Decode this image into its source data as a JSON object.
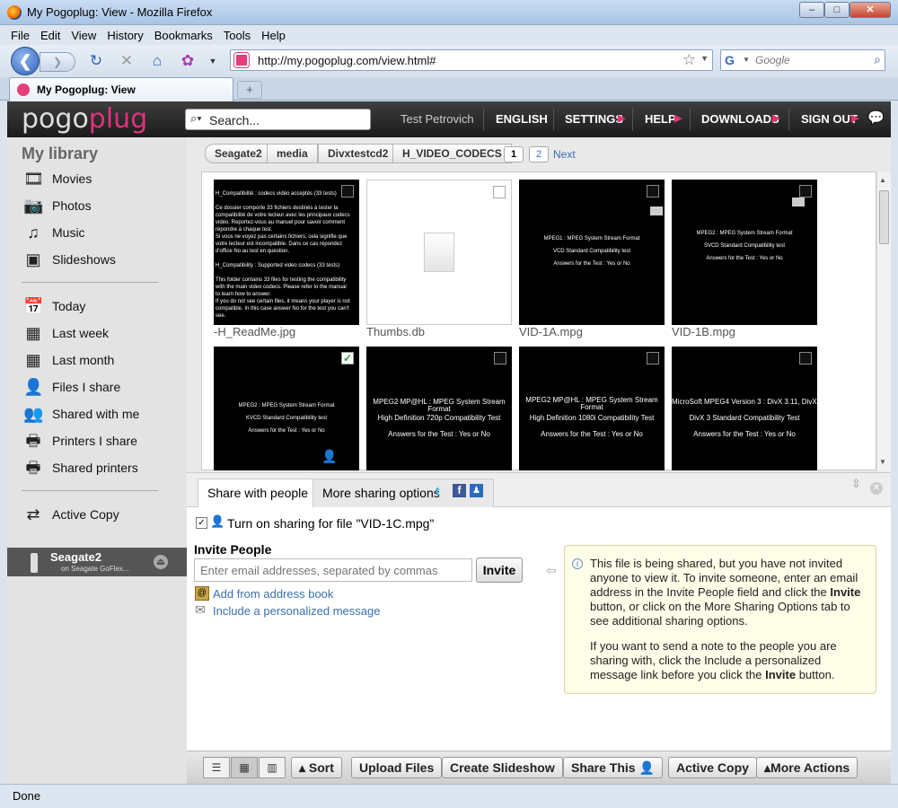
{
  "window": {
    "title": "My Pogoplug: View - Mozilla Firefox",
    "min": "–",
    "max": "□",
    "close": "✕"
  },
  "menu": [
    "File",
    "Edit",
    "View",
    "History",
    "Bookmarks",
    "Tools",
    "Help"
  ],
  "nav": {
    "url": "http://my.pogoplug.com/view.html#",
    "search_placeholder": "Google"
  },
  "tab": {
    "title": "My Pogoplug: View",
    "newtab": "+"
  },
  "header": {
    "logo_a": "pogo",
    "logo_b": "plug",
    "search_text": "Search...",
    "user": "Test Petrovich",
    "language": "ENGLISH",
    "settings": "SETTINGS",
    "help": "HELP",
    "downloads": "DOWNLOADS",
    "signout": "SIGN OUT"
  },
  "sidebar": {
    "title": "My library",
    "media": [
      {
        "label": "Movies",
        "icon": "film-icon"
      },
      {
        "label": "Photos",
        "icon": "camera-icon"
      },
      {
        "label": "Music",
        "icon": "music-note-icon"
      },
      {
        "label": "Slideshows",
        "icon": "slideshow-icon"
      }
    ],
    "time": [
      {
        "label": "Today",
        "icon": "calendar-day-icon"
      },
      {
        "label": "Last week",
        "icon": "calendar-week-icon"
      },
      {
        "label": "Last month",
        "icon": "calendar-month-icon"
      },
      {
        "label": "Files I share",
        "icon": "user-share-icon"
      },
      {
        "label": "Shared with me",
        "icon": "users-icon"
      },
      {
        "label": "Printers I share",
        "icon": "printer-share-icon"
      },
      {
        "label": "Shared printers",
        "icon": "printer-icon"
      }
    ],
    "activecopy": "Active Copy",
    "device": {
      "name": "Seagate2",
      "sub": "on Seagate GoFlex..."
    }
  },
  "breadcrumb": [
    "Seagate2",
    "media",
    "Divxtestcd2",
    "H_VIDEO_CODECS"
  ],
  "pagination": {
    "p1": "1",
    "p2": "2",
    "next": "Next"
  },
  "files": [
    {
      "name": "-H_ReadMe.jpg",
      "lines": [
        "H_Compatibilité : codecs vidéo acceptés (33 tests)",
        "",
        "Ce dossier comporte 33 fichiers destinés à tester la",
        "compatibilité de votre lecteur avec les principaux codecs",
        "vidéo. Reportez-vous au manuel pour savoir comment",
        "répondre à chaque test.",
        "Si vous ne voyez pas certains fichiers, cela signifie que",
        "votre lecteur est incompatible. Dans ce cas répondez",
        "d'office No au test en question.",
        "",
        "H_Compatibility : Supported video codecs  (33 tests)",
        "",
        "This folder contains 33 files for testing the compatibility",
        "with the main video codecs. Please refer to the manual",
        "to learn how to answer.",
        "If you do not see certain files, it means your player is not",
        "compatible. In this case answer No for the test you can't",
        "see."
      ]
    },
    {
      "name": "Thumbs.db",
      "lines": []
    },
    {
      "name": "VID-1A.mpg",
      "lines": [
        "MPEG1 : MPEG System Stream Format",
        "VCD Standard Compatibility test",
        "Answers for the Test : Yes or No"
      ]
    },
    {
      "name": "VID-1B.mpg",
      "lines": [
        "MPEG2 : MPEG System Stream Format",
        "SVCD Standard Compatibility test",
        "Answers for the Test : Yes or No"
      ]
    },
    {
      "name": "",
      "lines": [
        "MPEG2 : MPEG System Stream Format",
        "KVCD Standard Compatibility test",
        "Answers for the Test : Yes or No"
      ]
    },
    {
      "name": "",
      "lines": [
        "MPEG2 MP@HL : MPEG System Stream Format",
        "High Definition 720p Compatibility Test",
        "Answers for the Test : Yes or No"
      ]
    },
    {
      "name": "",
      "lines": [
        "MPEG2 MP@HL : MPEG System Stream Format",
        "High Definition 1080i Compatibility Test",
        "Answers for the Test : Yes or No"
      ]
    },
    {
      "name": "",
      "lines": [
        "MicroSoft MPEG4 Version 3 : DivX 3.11, DivX3.S2",
        "DivX 3 Standard Compatibility Test",
        "Answers for the Test : Yes or No"
      ]
    }
  ],
  "share": {
    "tab_people": "Share with people",
    "tab_more": "More sharing options",
    "toggle_label": "Turn on sharing for file \"VID-1C.mpg\"",
    "invite_heading": "Invite People",
    "email_placeholder": "Enter email addresses, separated by commas",
    "invite_button": "Invite",
    "address_book": "Add from address book",
    "personal_msg": "Include a personalized message",
    "info_1a": "This file is being shared, but you have not invited anyone to view it. To invite someone, enter an email address in the Invite People field and click the ",
    "info_1b": "Invite",
    "info_1c": " button, or click on the More Sharing Options tab to see additional sharing options.",
    "info_2a": "If you want to send a note to the people you are sharing with, click the Include a personalized message link before you click the ",
    "info_2b": "Invite",
    "info_2c": " button."
  },
  "toolbar": {
    "sort": "Sort",
    "upload": "Upload Files",
    "slideshow": "Create Slideshow",
    "share": "Share This",
    "activecopy": "Active Copy",
    "more": "More Actions"
  },
  "status": "Done",
  "colors": {
    "accent": "#e0327a",
    "header": "#2a2a2a",
    "sidebar": "#e3e3e3",
    "link": "#3a6fb0"
  }
}
